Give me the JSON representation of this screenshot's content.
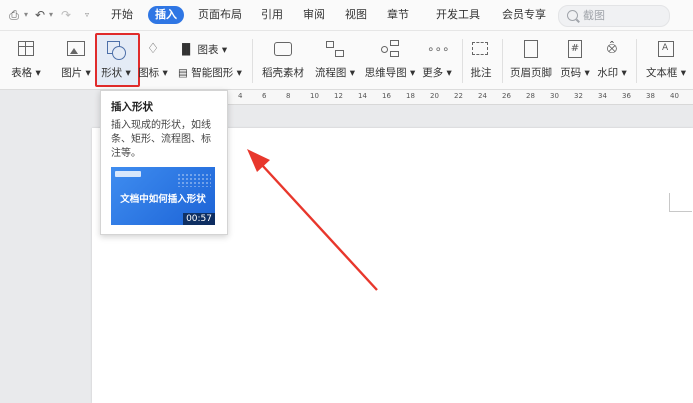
{
  "menubar": {
    "tabs": [
      {
        "label": "开始",
        "active": false
      },
      {
        "label": "插入",
        "active": true
      },
      {
        "label": "页面布局",
        "active": false
      },
      {
        "label": "引用",
        "active": false
      },
      {
        "label": "审阅",
        "active": false
      },
      {
        "label": "视图",
        "active": false
      },
      {
        "label": "章节",
        "active": false
      },
      {
        "label": "开发工具",
        "active": false
      },
      {
        "label": "会员专享",
        "active": false
      }
    ],
    "search_placeholder": "截图"
  },
  "ribbon": {
    "table": "表格",
    "picture": "图片",
    "shape": "形状",
    "icon": "图标",
    "chart": "图表",
    "smartart": "智能图形",
    "material": "稻壳素材",
    "flowchart": "流程图",
    "mindmap": "思维导图",
    "more": "更多",
    "comment": "批注",
    "header_footer": "页眉页脚",
    "page_number": "页码",
    "watermark": "水印",
    "textbox": "文本框"
  },
  "ruler": {
    "ticks": [
      "4",
      "6",
      "8",
      "10",
      "12",
      "14",
      "16",
      "18",
      "20",
      "22",
      "24",
      "26",
      "28",
      "30",
      "32",
      "34",
      "36",
      "38",
      "40"
    ]
  },
  "tooltip": {
    "title": "插入形状",
    "description": "插入现成的形状，如线条、矩形、流程图、标注等。",
    "video_title": "文档中如何插入形状",
    "video_duration": "00:57"
  },
  "colors": {
    "accent": "#2f76e4",
    "highlight_border": "#e02b2b",
    "arrow": "#e8372c"
  }
}
